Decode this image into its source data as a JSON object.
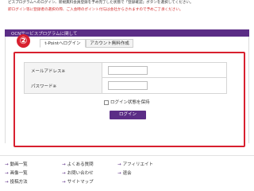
{
  "notice": {
    "line1": "ビスプログラムへのログイン、新規無料会員登録を予め完了した状態で「登録確認」ボタンを選択してください。",
    "line2": "即ログイン等に登録者の選択の際、ご入会時のポイント付与は会社からされますので予めご了承ください。"
  },
  "panel": {
    "header": "OCNサービスプログラムに関して"
  },
  "tabs": [
    {
      "label": "t-Pointへログイン"
    },
    {
      "label": "アカウント無料作成"
    }
  ],
  "step_badge": "②",
  "form": {
    "email_label": "メールアドレス※",
    "email_value": "",
    "password_label": "パスワード※",
    "password_value": "",
    "remember_label": "ログイン状態を保持",
    "remember_checked": false,
    "login_button": "ログイン"
  },
  "footer": {
    "links": [
      "動画一覧",
      "よくある質問",
      "アフィリエイト",
      "画像一覧",
      "お問い合わせ",
      "退会",
      "投稿方法",
      "サイトマップ"
    ]
  },
  "colors": {
    "accent_purple": "#5b2d86",
    "highlight_red": "#d8202f",
    "notice_red": "#d22b2b"
  }
}
